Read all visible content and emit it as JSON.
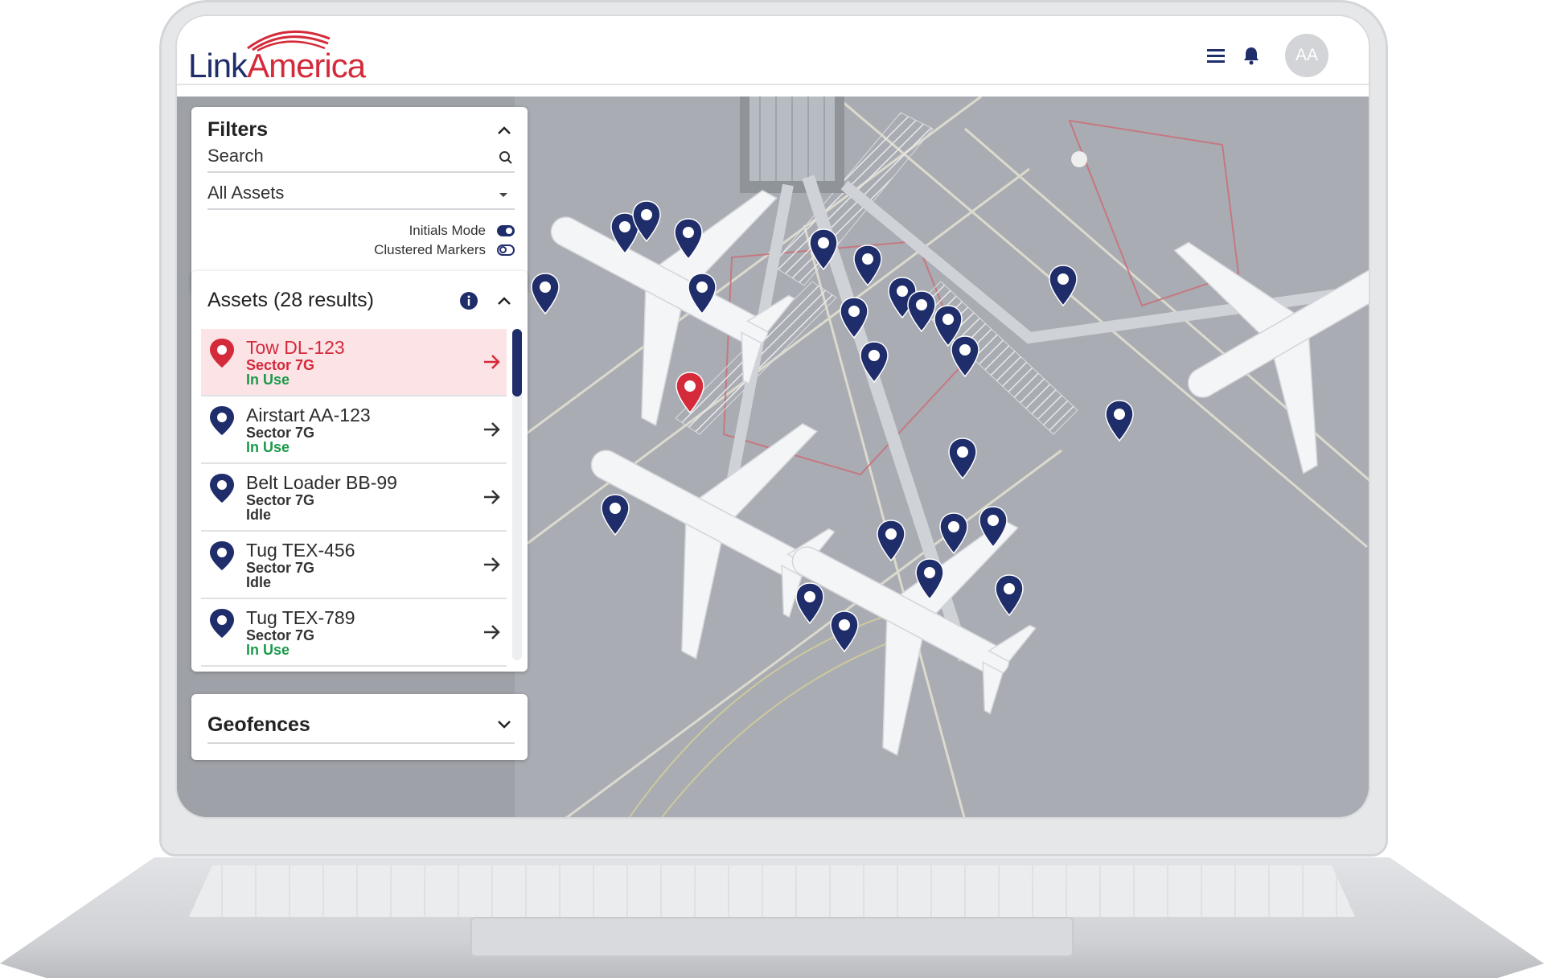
{
  "brand": {
    "name_part1": "Link",
    "name_part2": "America"
  },
  "header": {
    "avatar_initials": "AA"
  },
  "filters": {
    "title": "Filters",
    "search_label": "Search",
    "asset_select": "All Assets",
    "toggles": [
      {
        "label": "Initials Mode",
        "on": true
      },
      {
        "label": "Clustered Markers",
        "on": false
      }
    ]
  },
  "assets": {
    "title": "Assets (28 results)",
    "items": [
      {
        "name": "Tow DL-123",
        "sector": "Sector 7G",
        "status": "In Use",
        "selected": true
      },
      {
        "name": "Airstart AA-123",
        "sector": "Sector 7G",
        "status": "In Use",
        "selected": false
      },
      {
        "name": "Belt Loader BB-99",
        "sector": "Sector 7G",
        "status": "Idle",
        "selected": false
      },
      {
        "name": "Tug TEX-456",
        "sector": "Sector 7G",
        "status": "Idle",
        "selected": false
      },
      {
        "name": "Tug TEX-789",
        "sector": "Sector 7G",
        "status": "In Use",
        "selected": false
      }
    ]
  },
  "geofences": {
    "title": "Geofences"
  },
  "colors": {
    "navy": "#1f2d6b",
    "red": "#d42a3a",
    "green": "#1a9a4b"
  },
  "icons": [
    "menu-icon",
    "bell-icon",
    "search-icon",
    "info-icon",
    "chevron-up-icon",
    "chevron-down-icon",
    "map-pin-icon",
    "arrow-right-icon"
  ]
}
